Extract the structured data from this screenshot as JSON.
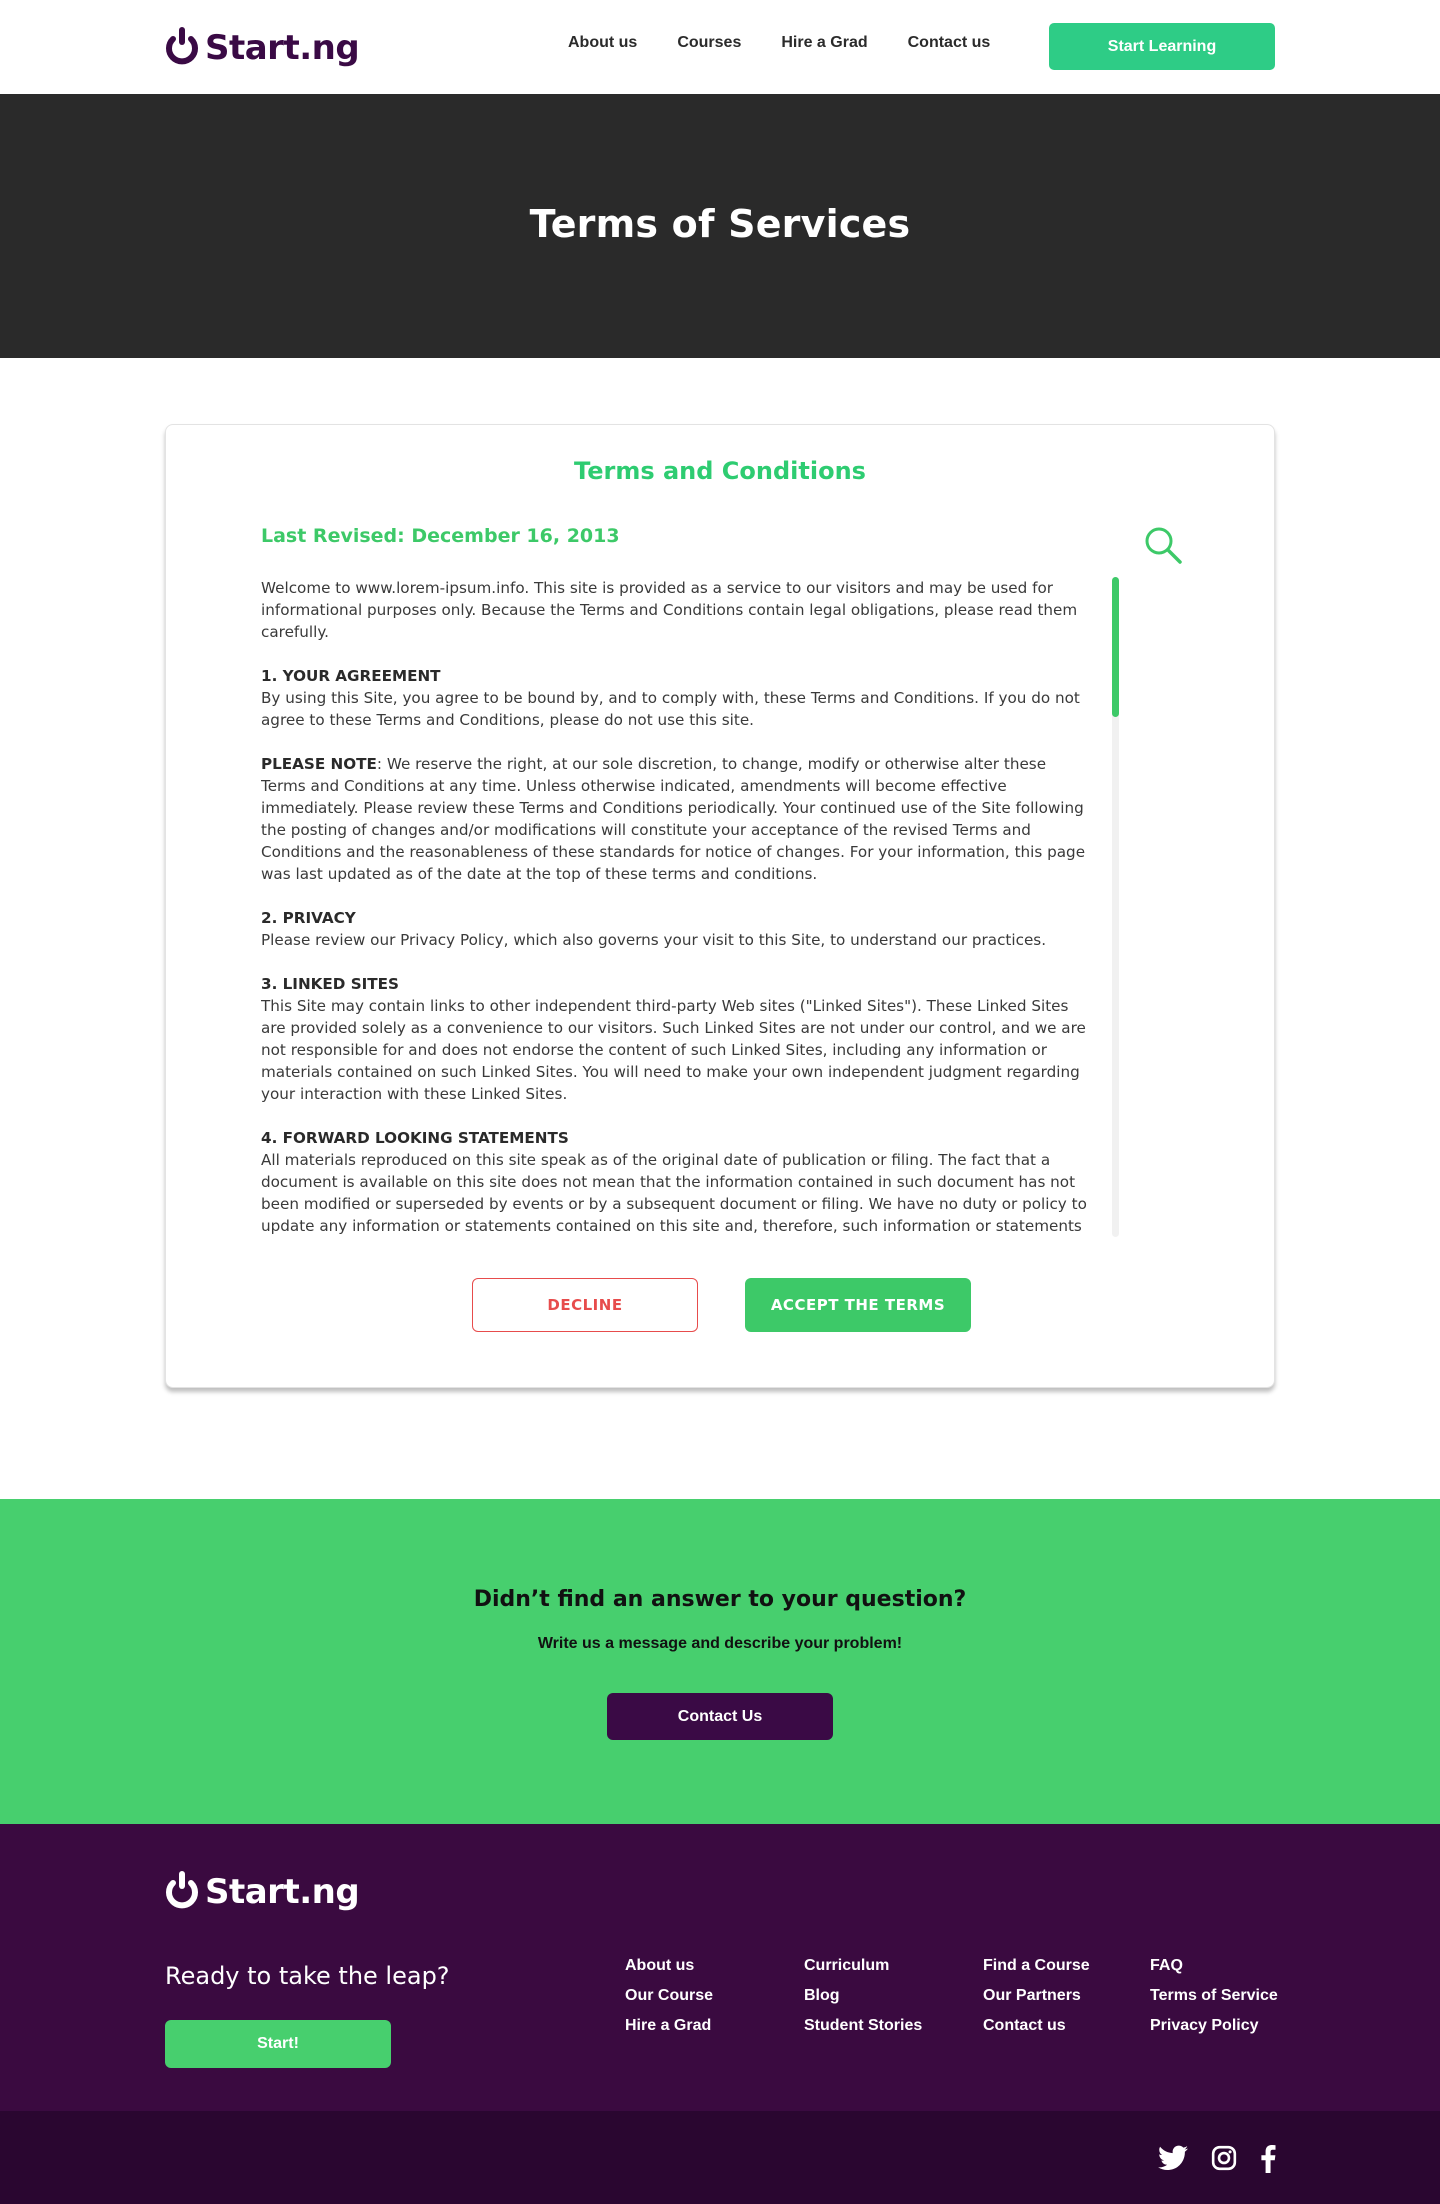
{
  "nav": {
    "logo_text": "Start.ng",
    "links": [
      "About us",
      "Courses",
      "Hire a Grad",
      "Contact us"
    ],
    "cta_label": "Start Learning"
  },
  "hero": {
    "title": "Terms of Services"
  },
  "terms": {
    "title": "Terms and Conditions",
    "last_revised": "Last Revised: December 16, 2013",
    "intro": "Welcome to www.lorem-ipsum.info. This site is provided as a service to our visitors and may be used for informational purposes only. Because the Terms and Conditions contain legal obligations, please read them carefully.",
    "s1_heading": "1. YOUR AGREEMENT",
    "s1_text": "By using this Site, you agree to be bound by, and to comply with, these Terms and Conditions. If you do not agree to these Terms and Conditions, please do not use this site.",
    "note_label": "PLEASE NOTE",
    "note_text": ": We reserve the right, at our sole discretion, to change, modify or otherwise alter these Terms and Conditions at any time. Unless otherwise indicated, amendments will become effective immediately. Please review these Terms and Conditions periodically. Your continued use of the Site following the posting of changes and/or modifications will constitute your acceptance of the revised Terms and Conditions and the reasonableness of these standards for notice of changes. For your information, this page was last updated as of the date at the top of these terms and conditions.",
    "s2_heading": "2. PRIVACY",
    "s2_text": "Please review our Privacy Policy, which also governs your visit to this Site, to understand our practices.",
    "s3_heading": "3. LINKED SITES",
    "s3_text": "This Site may contain links to other independent third-party Web sites (\"Linked Sites\"). These Linked Sites are provided solely as a convenience to our visitors. Such Linked Sites are not under our control, and we are not responsible for and does not endorse the content of such Linked Sites, including any information or materials contained on such Linked Sites. You will need to make your own independent judgment regarding your interaction with these Linked Sites.",
    "s4_heading": "4. FORWARD LOOKING STATEMENTS",
    "s4_text": "All materials reproduced on this site speak as of the original date of publication or filing. The fact that a document is available on this site does not mean that the information contained in such document has not been modified or superseded by events or by a subsequent document or filing. We have no duty or policy to update any information or statements contained on this site and, therefore, such information or statements",
    "decline_label": "DECLINE",
    "accept_label": "ACCEPT THE TERMS"
  },
  "cta": {
    "heading": "Didn’t find an answer to your question?",
    "subheading": "Write us a message and describe your problem!",
    "button_label": "Contact Us"
  },
  "footer": {
    "logo_text": "Start.ng",
    "tagline": "Ready to take the leap?",
    "start_label": "Start!",
    "col1": [
      "About us",
      "Our Course",
      "Hire a Grad"
    ],
    "col2": [
      "Curriculum",
      "Blog",
      "Student Stories"
    ],
    "col3": [
      "Find a Course",
      "Our Partners",
      "Contact us"
    ],
    "col4": [
      "FAQ",
      "Terms of Service",
      "Privacy Policy"
    ]
  },
  "social_icons": [
    "twitter-icon",
    "instagram-icon",
    "facebook-icon"
  ],
  "colors": {
    "brand_purple": "#3a0a45",
    "accent_green": "#47cf6e",
    "nav_button_green": "#2ecc86",
    "decline_red": "#e74c4c",
    "hero_bg": "#2a2a2a"
  }
}
